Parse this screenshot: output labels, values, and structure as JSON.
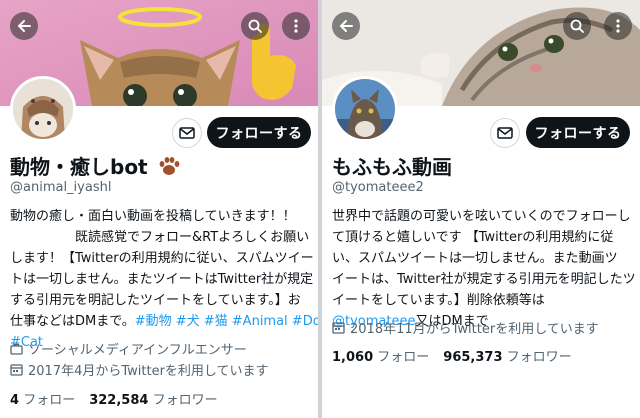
{
  "left": {
    "name": "動物・癒しbot",
    "handle": "@animal_iyashl",
    "follow_label": "フォローする",
    "bio_lines": [
      [
        {
          "t": "動物の癒し・面白い動画を投稿していきます！！"
        }
      ],
      [
        {
          "t": "　　　　　既読感覚でフォロー&RTよろしくお願い"
        }
      ],
      [
        {
          "t": "します！【Twitterの利用規約に従い、スパムツイー"
        }
      ],
      [
        {
          "t": "トは一切しません。またツイートはTwitter社が規定"
        }
      ],
      [
        {
          "t": "する引用元を明記したツイートをしています。】お"
        }
      ],
      [
        {
          "t": "仕事などはDMまで。"
        },
        {
          "t": "#動物 #犬 #猫 #Animal #Dod",
          "link": true
        }
      ],
      [
        {
          "t": "#Cat",
          "link": true
        }
      ]
    ],
    "category": "ソーシャルメディアインフルエンサー",
    "joined": "2017年4月からTwitterを利用しています",
    "following_count": "4",
    "following_label": "フォロー",
    "followers_count": "322,584",
    "followers_label": "フォロワー"
  },
  "right": {
    "name": "もふもふ動画",
    "handle": "@tyomateee2",
    "follow_label": "フォローする",
    "bio_lines": [
      [
        {
          "t": "世界中で話題の可愛いを呟いていくのでフォローし"
        }
      ],
      [
        {
          "t": "て頂けると嬉しいです 【Twitterの利用規約に従"
        }
      ],
      [
        {
          "t": "い、スパムツイートは一切しません。また動画ツ"
        }
      ],
      [
        {
          "t": "イートは、Twitter社が規定する引用元を明記したツ"
        }
      ],
      [
        {
          "t": "イートをしています。】削除依頼等は"
        }
      ],
      [
        {
          "t": "@tyomateee",
          "link": true
        },
        {
          "t": "又はDMまで"
        }
      ]
    ],
    "joined": "2018年11月からTwitterを利用しています",
    "following_count": "1,060",
    "following_label": "フォロー",
    "followers_count": "965,373",
    "followers_label": "フォロワー"
  },
  "colors": {
    "link": "#1d9bf0",
    "secondary_text": "#536471",
    "follow_button": "#0f1419",
    "left_banner": "#e8a9c9",
    "right_banner": "#e9e6e2"
  },
  "icons": {
    "back": "arrow-left-icon",
    "search": "search-icon",
    "more": "more-vertical-icon",
    "mail": "mail-icon",
    "category": "briefcase-icon",
    "joined": "calendar-icon"
  }
}
